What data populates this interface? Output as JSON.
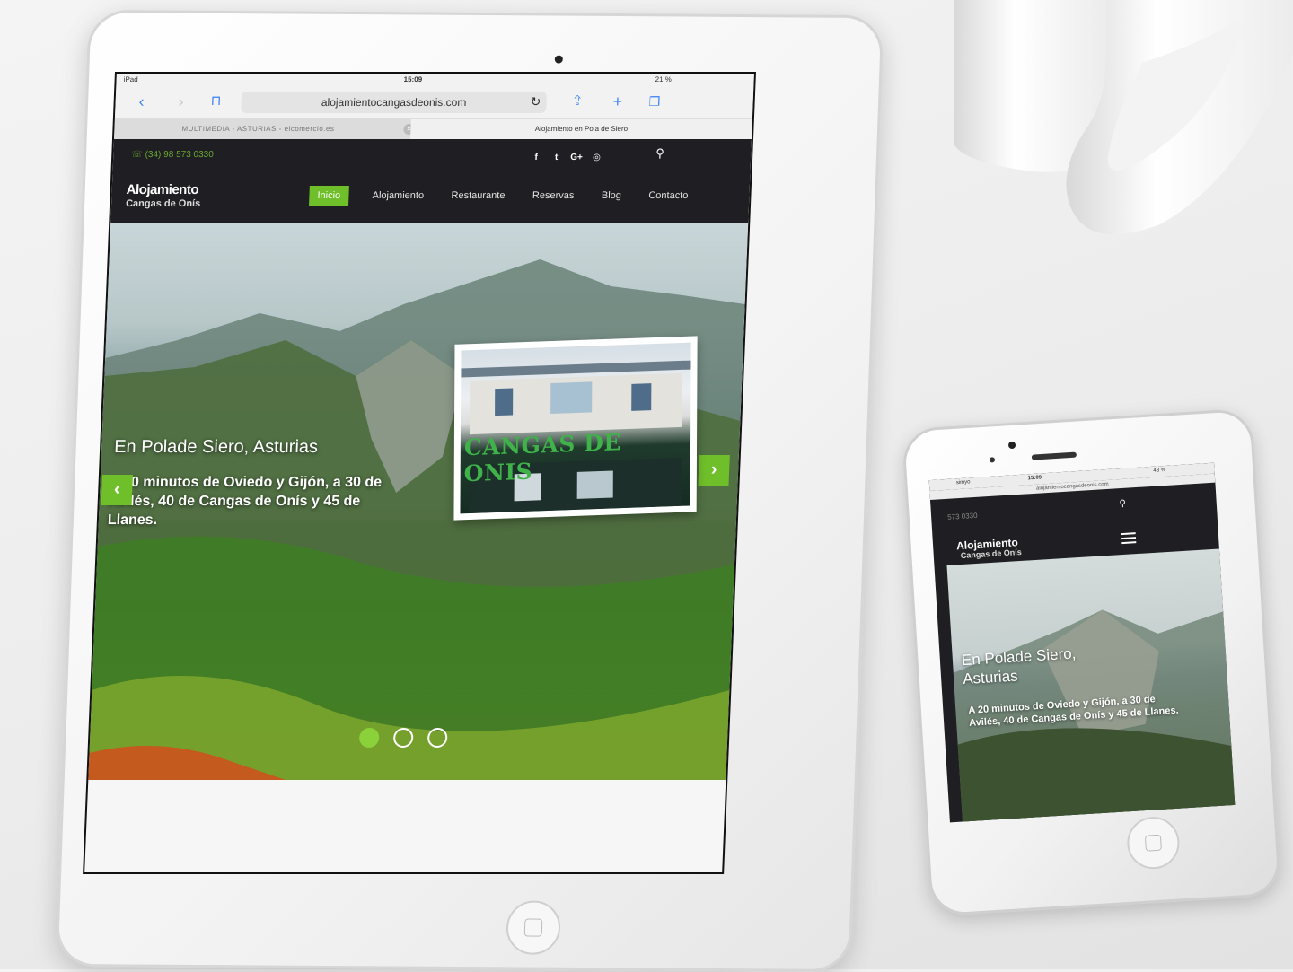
{
  "ipad": {
    "status": {
      "device": "iPad",
      "time": "15:09",
      "battery": "21 %"
    },
    "safari": {
      "url": "alojamientocangasdeonis.com",
      "tab_inactive": "MULTIMEDIA - ASTURIAS - elcomercio.es",
      "tab_active": "Alojamiento en Pola de Siero"
    },
    "site": {
      "phone": "(34) 98 573 0330",
      "socials": [
        "f",
        "t",
        "G+",
        "◎"
      ],
      "logo_line1": "Alojamiento",
      "logo_line2": "Cangas de Onís",
      "menu": [
        "Inicio",
        "Alojamiento",
        "Restaurante",
        "Reservas",
        "Blog",
        "Contacto"
      ],
      "hero_title": "En Polade Siero, Asturias",
      "hero_text": "A 20 minutos de Oviedo y Gijón, a 30 de Avilés, 40 de Cangas de Onís y 45 de Llanes.",
      "photo_sign": "CANGAS DE ONIS",
      "slider_active_index": 0,
      "slider_count": 3
    }
  },
  "iphone": {
    "status": {
      "carrier": "simyo",
      "time": "15:09",
      "battery": "48 %"
    },
    "url": "alojamientocangasdeonis.com",
    "phone": "573 0330",
    "logo_line1": "Alojamiento",
    "logo_line2": "Cangas de Onís",
    "hero_title": "En Polade Siero, Asturias",
    "hero_text": "A 20 minutos de Oviedo y Gijón, a 30 de Avilés, 40 de Cangas de Onís y 45 de Llanes."
  },
  "colors": {
    "accent": "#6fbf2a",
    "site_dark": "#1f1f23",
    "link_blue": "#3b82f6"
  },
  "icons": [
    "back-icon",
    "forward-icon",
    "bookmarks-icon",
    "reload-icon",
    "share-icon",
    "new-tab-icon",
    "tabs-icon",
    "search-icon",
    "menu-icon",
    "home-button-icon"
  ]
}
